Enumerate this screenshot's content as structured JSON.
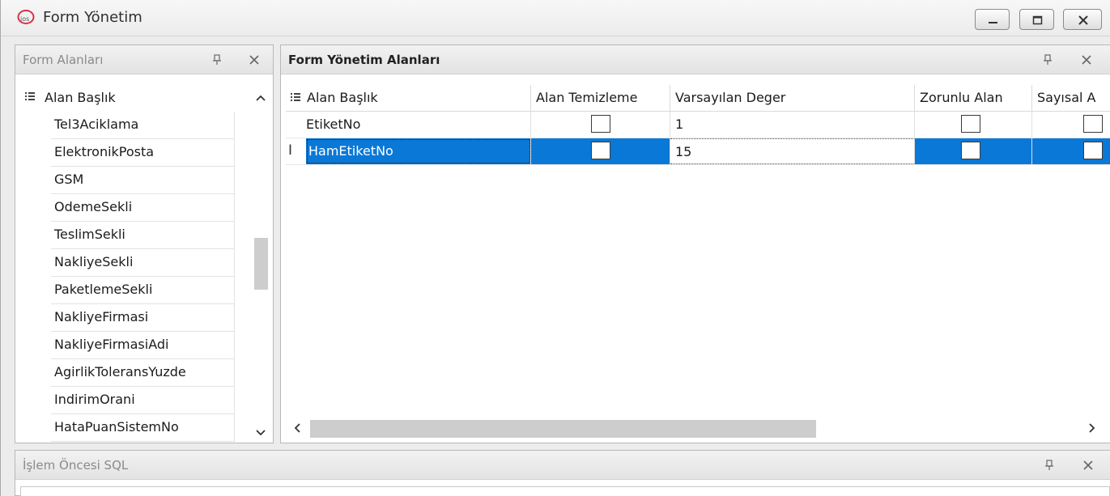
{
  "window": {
    "title": "Form Yönetim"
  },
  "left_panel": {
    "title": "Form Alanları",
    "column_header": "Alan Başlık",
    "items": [
      "Tel3Aciklama",
      "ElektronikPosta",
      "GSM",
      "OdemeSekli",
      "TeslimSekli",
      "NakliyeSekli",
      "PaketlemeSekli",
      "NakliyeFirmasi",
      "NakliyeFirmasiAdi",
      "AgirlikToleransYuzde",
      "IndirimOrani",
      "HataPuanSistemNo"
    ]
  },
  "right_panel": {
    "title": "Form Yönetim Alanları",
    "columns": [
      "Alan Başlık",
      "Alan Temizleme",
      "Varsayılan Deger",
      "Zorunlu Alan",
      "Sayısal A"
    ],
    "rows": [
      {
        "alan_baslik": "EtiketNo",
        "alan_temizleme": false,
        "varsayilan_deger": "1",
        "zorunlu_alan": false,
        "sayisal": false,
        "selected": false
      },
      {
        "alan_baslik": "HamEtiketNo",
        "alan_temizleme": false,
        "varsayilan_deger": "15",
        "zorunlu_alan": false,
        "sayisal": false,
        "selected": true
      }
    ]
  },
  "bottom_panel": {
    "title": "İşlem Öncesi SQL"
  },
  "colors": {
    "selection": "#0a78d7",
    "logo": "#d6334b"
  },
  "icons": {
    "app": "ios-logo-icon",
    "pin": "pin-icon",
    "close": "close-icon",
    "grip": "column-chooser-icon",
    "row_indicator": "text-cursor-icon"
  }
}
